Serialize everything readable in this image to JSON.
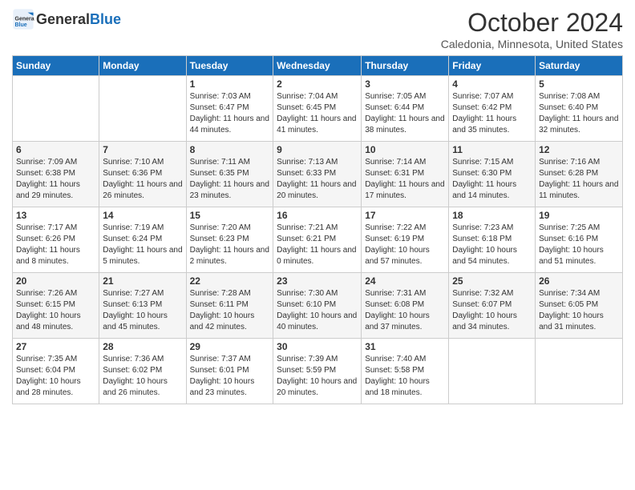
{
  "header": {
    "logo_general": "General",
    "logo_blue": "Blue",
    "month_title": "October 2024",
    "location": "Caledonia, Minnesota, United States"
  },
  "days_of_week": [
    "Sunday",
    "Monday",
    "Tuesday",
    "Wednesday",
    "Thursday",
    "Friday",
    "Saturday"
  ],
  "weeks": [
    [
      {
        "num": "",
        "info": ""
      },
      {
        "num": "",
        "info": ""
      },
      {
        "num": "1",
        "info": "Sunrise: 7:03 AM\nSunset: 6:47 PM\nDaylight: 11 hours and 44 minutes."
      },
      {
        "num": "2",
        "info": "Sunrise: 7:04 AM\nSunset: 6:45 PM\nDaylight: 11 hours and 41 minutes."
      },
      {
        "num": "3",
        "info": "Sunrise: 7:05 AM\nSunset: 6:44 PM\nDaylight: 11 hours and 38 minutes."
      },
      {
        "num": "4",
        "info": "Sunrise: 7:07 AM\nSunset: 6:42 PM\nDaylight: 11 hours and 35 minutes."
      },
      {
        "num": "5",
        "info": "Sunrise: 7:08 AM\nSunset: 6:40 PM\nDaylight: 11 hours and 32 minutes."
      }
    ],
    [
      {
        "num": "6",
        "info": "Sunrise: 7:09 AM\nSunset: 6:38 PM\nDaylight: 11 hours and 29 minutes."
      },
      {
        "num": "7",
        "info": "Sunrise: 7:10 AM\nSunset: 6:36 PM\nDaylight: 11 hours and 26 minutes."
      },
      {
        "num": "8",
        "info": "Sunrise: 7:11 AM\nSunset: 6:35 PM\nDaylight: 11 hours and 23 minutes."
      },
      {
        "num": "9",
        "info": "Sunrise: 7:13 AM\nSunset: 6:33 PM\nDaylight: 11 hours and 20 minutes."
      },
      {
        "num": "10",
        "info": "Sunrise: 7:14 AM\nSunset: 6:31 PM\nDaylight: 11 hours and 17 minutes."
      },
      {
        "num": "11",
        "info": "Sunrise: 7:15 AM\nSunset: 6:30 PM\nDaylight: 11 hours and 14 minutes."
      },
      {
        "num": "12",
        "info": "Sunrise: 7:16 AM\nSunset: 6:28 PM\nDaylight: 11 hours and 11 minutes."
      }
    ],
    [
      {
        "num": "13",
        "info": "Sunrise: 7:17 AM\nSunset: 6:26 PM\nDaylight: 11 hours and 8 minutes."
      },
      {
        "num": "14",
        "info": "Sunrise: 7:19 AM\nSunset: 6:24 PM\nDaylight: 11 hours and 5 minutes."
      },
      {
        "num": "15",
        "info": "Sunrise: 7:20 AM\nSunset: 6:23 PM\nDaylight: 11 hours and 2 minutes."
      },
      {
        "num": "16",
        "info": "Sunrise: 7:21 AM\nSunset: 6:21 PM\nDaylight: 11 hours and 0 minutes."
      },
      {
        "num": "17",
        "info": "Sunrise: 7:22 AM\nSunset: 6:19 PM\nDaylight: 10 hours and 57 minutes."
      },
      {
        "num": "18",
        "info": "Sunrise: 7:23 AM\nSunset: 6:18 PM\nDaylight: 10 hours and 54 minutes."
      },
      {
        "num": "19",
        "info": "Sunrise: 7:25 AM\nSunset: 6:16 PM\nDaylight: 10 hours and 51 minutes."
      }
    ],
    [
      {
        "num": "20",
        "info": "Sunrise: 7:26 AM\nSunset: 6:15 PM\nDaylight: 10 hours and 48 minutes."
      },
      {
        "num": "21",
        "info": "Sunrise: 7:27 AM\nSunset: 6:13 PM\nDaylight: 10 hours and 45 minutes."
      },
      {
        "num": "22",
        "info": "Sunrise: 7:28 AM\nSunset: 6:11 PM\nDaylight: 10 hours and 42 minutes."
      },
      {
        "num": "23",
        "info": "Sunrise: 7:30 AM\nSunset: 6:10 PM\nDaylight: 10 hours and 40 minutes."
      },
      {
        "num": "24",
        "info": "Sunrise: 7:31 AM\nSunset: 6:08 PM\nDaylight: 10 hours and 37 minutes."
      },
      {
        "num": "25",
        "info": "Sunrise: 7:32 AM\nSunset: 6:07 PM\nDaylight: 10 hours and 34 minutes."
      },
      {
        "num": "26",
        "info": "Sunrise: 7:34 AM\nSunset: 6:05 PM\nDaylight: 10 hours and 31 minutes."
      }
    ],
    [
      {
        "num": "27",
        "info": "Sunrise: 7:35 AM\nSunset: 6:04 PM\nDaylight: 10 hours and 28 minutes."
      },
      {
        "num": "28",
        "info": "Sunrise: 7:36 AM\nSunset: 6:02 PM\nDaylight: 10 hours and 26 minutes."
      },
      {
        "num": "29",
        "info": "Sunrise: 7:37 AM\nSunset: 6:01 PM\nDaylight: 10 hours and 23 minutes."
      },
      {
        "num": "30",
        "info": "Sunrise: 7:39 AM\nSunset: 5:59 PM\nDaylight: 10 hours and 20 minutes."
      },
      {
        "num": "31",
        "info": "Sunrise: 7:40 AM\nSunset: 5:58 PM\nDaylight: 10 hours and 18 minutes."
      },
      {
        "num": "",
        "info": ""
      },
      {
        "num": "",
        "info": ""
      }
    ]
  ]
}
